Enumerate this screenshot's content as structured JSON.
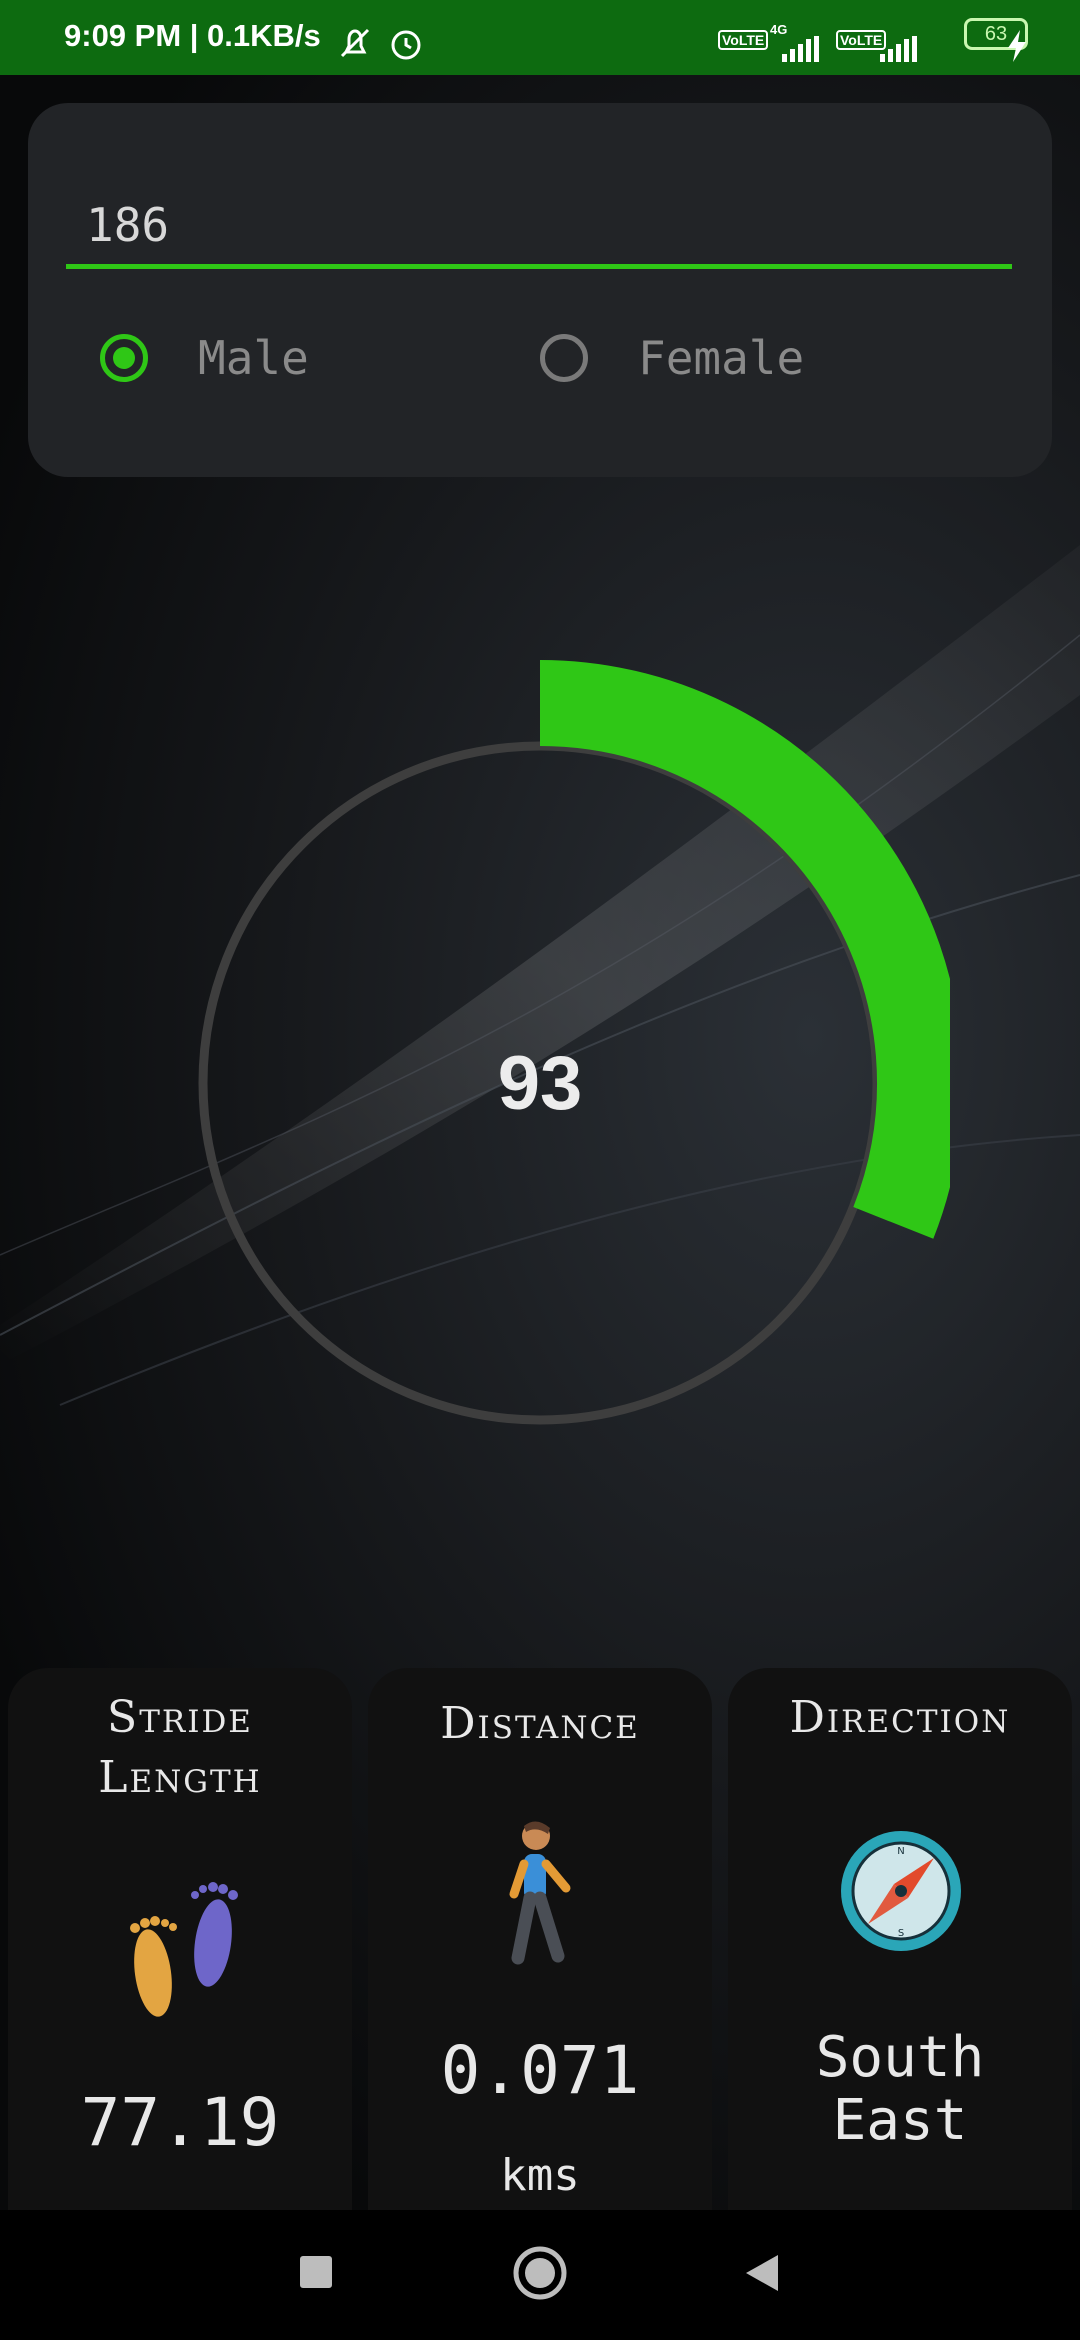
{
  "status_bar": {
    "time_speed": "9:09 PM | 0.1KB/s",
    "network_1": "VoLTE",
    "network_type": "4G",
    "network_2": "VoLTE",
    "battery": "63",
    "icons": [
      "mute-bell-icon",
      "alarm-icon",
      "signal-icon",
      "signal-icon",
      "battery-icon",
      "charging-icon"
    ]
  },
  "form": {
    "height_value": "186",
    "gender_options": [
      {
        "label": "Male",
        "checked": true
      },
      {
        "label": "Female",
        "checked": false
      }
    ]
  },
  "gauge": {
    "value": "93",
    "progress_fraction": 0.31,
    "colors": {
      "track": "#3e3e3e",
      "progress": "#2fc716"
    }
  },
  "stats": [
    {
      "title_line1": "Stride",
      "title_line2": "Length",
      "value": "77.19",
      "unit": "",
      "icon": "footprints-icon"
    },
    {
      "title_line1": "Distance",
      "title_line2": "",
      "value": "0.071",
      "unit": "kms",
      "icon": "walking-person-icon"
    },
    {
      "title_line1": "Direction",
      "title_line2": "",
      "value_line1": "South",
      "value_line2": "East",
      "unit": "",
      "icon": "compass-icon"
    }
  ],
  "colors": {
    "accent": "#2fc716",
    "status_bar": "#0d6b10"
  }
}
